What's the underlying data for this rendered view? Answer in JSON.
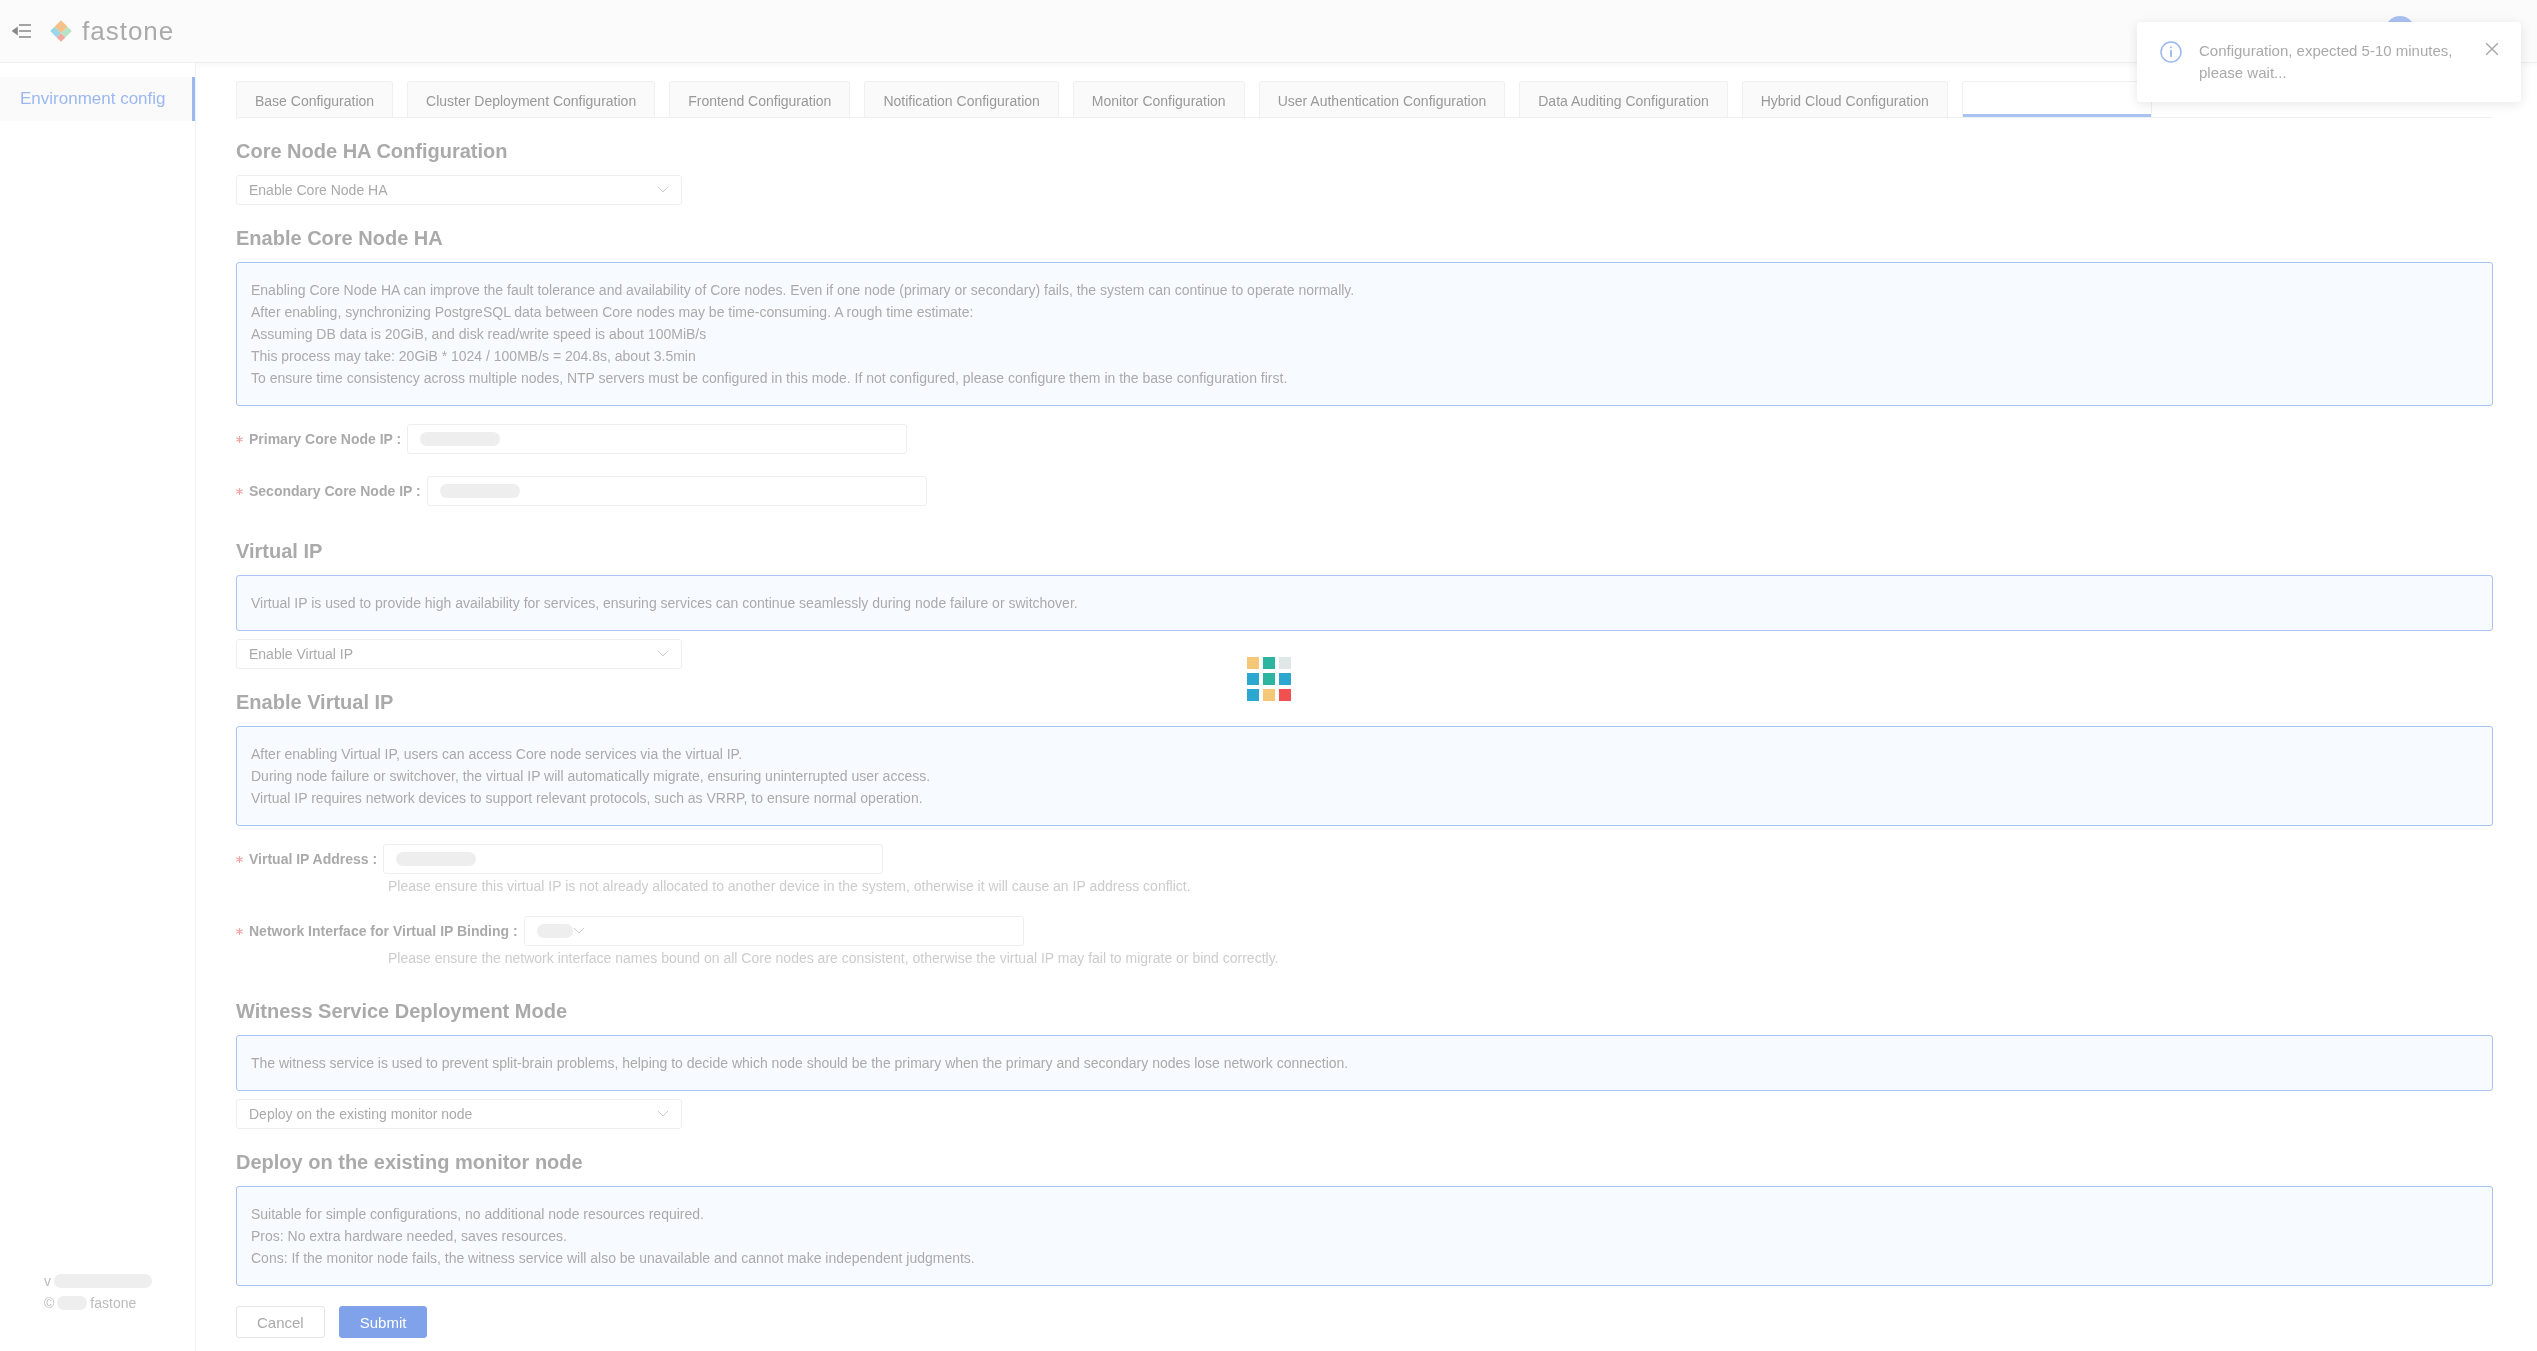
{
  "header": {
    "brand": "fastone"
  },
  "sidebar": {
    "items": [
      {
        "label": "Environment config",
        "selected": true
      }
    ],
    "footer": {
      "version_prefix": "v",
      "copyright_prefix": "©",
      "company": "fastone"
    }
  },
  "tabs": [
    {
      "label": "Base Configuration",
      "selected": false
    },
    {
      "label": "Cluster Deployment Configuration",
      "selected": false
    },
    {
      "label": "Frontend Configuration",
      "selected": false
    },
    {
      "label": "Notification Configuration",
      "selected": false
    },
    {
      "label": "Monitor Configuration",
      "selected": false
    },
    {
      "label": "User Authentication Configuration",
      "selected": false
    },
    {
      "label": "Data Auditing Configuration",
      "selected": false
    },
    {
      "label": "Hybrid Cloud Configuration",
      "selected": false
    },
    {
      "selected": true
    }
  ],
  "blocks": [
    {
      "kind": "heading",
      "text": "Core Node HA Configuration"
    },
    {
      "kind": "select",
      "value": "Enable Core Node HA"
    },
    {
      "kind": "heading",
      "text": "Enable Core Node HA"
    },
    {
      "kind": "info",
      "lines": [
        "Enabling Core Node HA can improve the fault tolerance and availability of Core nodes. Even if one node (primary or secondary) fails, the system can continue to operate normally.",
        "After enabling, synchronizing PostgreSQL data between Core nodes may be time-consuming. A rough time estimate:",
        "Assuming DB data is 20GiB, and disk read/write speed is about 100MiB/s",
        "This process may take: 20GiB * 1024 / 100MB/s = 204.8s, about 3.5min",
        "To ensure time consistency across multiple nodes, NTP servers must be configured in this mode. If not configured, please configure them in the base configuration first."
      ]
    },
    {
      "kind": "text_field",
      "label": "Primary Core Node IP :",
      "required": true
    },
    {
      "kind": "text_field",
      "label": "Secondary Core Node IP :",
      "required": true
    },
    {
      "kind": "heading",
      "text": "Virtual IP"
    },
    {
      "kind": "info",
      "lines": [
        "Virtual IP is used to provide high availability for services, ensuring services can continue seamlessly during node failure or switchover."
      ]
    },
    {
      "kind": "select",
      "value": "Enable Virtual IP"
    },
    {
      "kind": "heading",
      "text": "Enable Virtual IP"
    },
    {
      "kind": "info",
      "lines": [
        "After enabling Virtual IP, users can access Core node services via the virtual IP.",
        "During node failure or switchover, the virtual IP will automatically migrate, ensuring uninterrupted user access.",
        "Virtual IP requires network devices to support relevant protocols, such as VRRP, to ensure normal operation."
      ]
    },
    {
      "kind": "text_field",
      "label": "Virtual IP Address :",
      "required": true,
      "help": "Please ensure this virtual IP is not already allocated to another device in the system, otherwise it will cause an IP address conflict."
    },
    {
      "kind": "dropdown_field",
      "label": "Network Interface for Virtual IP Binding :",
      "required": true,
      "help": "Please ensure the network interface names bound on all Core nodes are consistent, otherwise the virtual IP may fail to migrate or bind correctly."
    },
    {
      "kind": "heading",
      "text": "Witness Service Deployment Mode"
    },
    {
      "kind": "info",
      "lines": [
        "The witness service is used to prevent split-brain problems, helping to decide which node should be the primary when the primary and secondary nodes lose network connection."
      ]
    },
    {
      "kind": "select",
      "value": "Deploy on the existing monitor node"
    },
    {
      "kind": "heading",
      "text": "Deploy on the existing monitor node"
    },
    {
      "kind": "info",
      "lines": [
        "Suitable for simple configurations, no additional node resources required.",
        "Pros: No extra hardware needed, saves resources.",
        "Cons: If the monitor node fails, the witness service will also be unavailable and cannot make independent judgments."
      ]
    }
  ],
  "buttons": [
    {
      "label": "Cancel",
      "kind": "default",
      "disabled": false
    },
    {
      "label": "Submit",
      "kind": "primary",
      "disabled": true
    }
  ],
  "toast": {
    "message": "Configuration, expected 5-10 minutes, please wait..."
  }
}
